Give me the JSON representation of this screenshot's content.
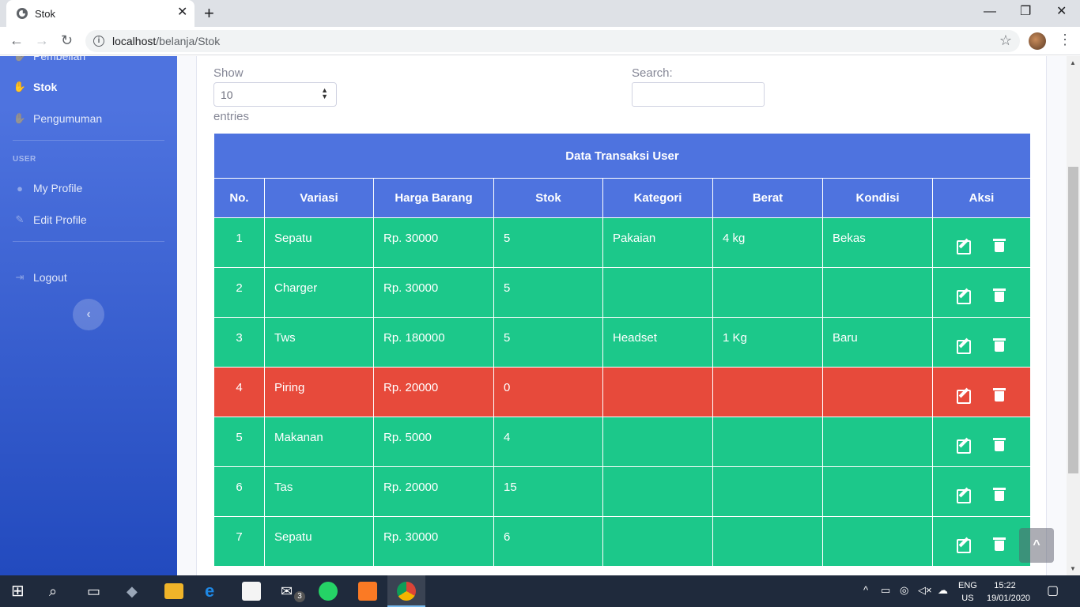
{
  "browser": {
    "tab_title": "Stok",
    "url_host": "localhost",
    "url_path": "/belanja/Stok"
  },
  "sidebar": {
    "items_top": [
      {
        "label": "Pembelian",
        "icon": "handshake-icon"
      },
      {
        "label": "Stok",
        "icon": "handshake-icon",
        "active": true
      },
      {
        "label": "Pengumuman",
        "icon": "handshake-icon"
      }
    ],
    "heading_user": "USER",
    "items_user": [
      {
        "label": "My Profile",
        "icon": "user-icon"
      },
      {
        "label": "Edit Profile",
        "icon": "edit-icon"
      }
    ],
    "logout": "Logout"
  },
  "controls": {
    "show_label": "Show",
    "page_size": "10",
    "entries_label": "entries",
    "search_label": "Search:",
    "search_value": ""
  },
  "table": {
    "caption": "Data Transaksi User",
    "headers": [
      "No.",
      "Variasi",
      "Harga Barang",
      "Stok",
      "Kategori",
      "Berat",
      "Kondisi",
      "Aksi"
    ],
    "rows": [
      {
        "no": "1",
        "variasi": "Sepatu",
        "harga": "Rp. 30000",
        "stok": "5",
        "kategori": "Pakaian",
        "berat": "4 kg",
        "kondisi": "Bekas"
      },
      {
        "no": "2",
        "variasi": "Charger",
        "harga": "Rp. 30000",
        "stok": "5",
        "kategori": "",
        "berat": "",
        "kondisi": ""
      },
      {
        "no": "3",
        "variasi": "Tws",
        "harga": "Rp. 180000",
        "stok": "5",
        "kategori": "Headset",
        "berat": "1 Kg",
        "kondisi": "Baru"
      },
      {
        "no": "4",
        "variasi": "Piring",
        "harga": "Rp. 20000",
        "stok": "0",
        "kategori": "",
        "berat": "",
        "kondisi": ""
      },
      {
        "no": "5",
        "variasi": "Makanan",
        "harga": "Rp. 5000",
        "stok": "4",
        "kategori": "",
        "berat": "",
        "kondisi": ""
      },
      {
        "no": "6",
        "variasi": "Tas",
        "harga": "Rp. 20000",
        "stok": "15",
        "kategori": "",
        "berat": "",
        "kondisi": ""
      },
      {
        "no": "7",
        "variasi": "Sepatu",
        "harga": "Rp. 30000",
        "stok": "6",
        "kategori": "",
        "berat": "",
        "kondisi": ""
      }
    ]
  },
  "colors": {
    "primary": "#4e73df",
    "in_stock": "#1cc88a",
    "out_of_stock": "#e74a3b"
  },
  "taskbar": {
    "lang_line1": "ENG",
    "lang_line2": "US",
    "time": "15:22",
    "date": "19/01/2020",
    "mail_badge": "3"
  }
}
